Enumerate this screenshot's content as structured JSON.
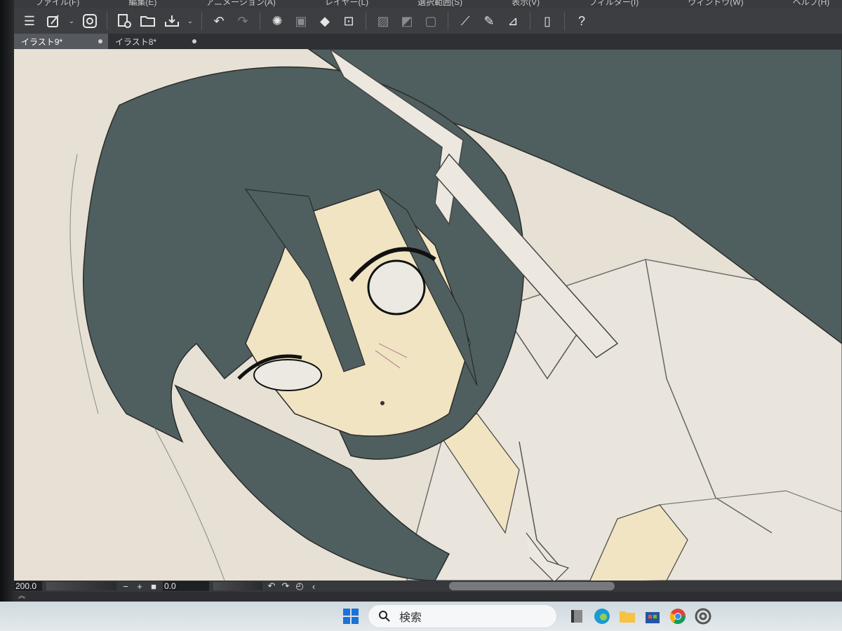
{
  "menu": [
    "ファイル(F)",
    "編集(E)",
    "アニメーション(A)",
    "レイヤー(L)",
    "選択範囲(S)",
    "表示(V)",
    "フィルター(I)",
    "ウィンドウ(W)",
    "ヘルプ(H)"
  ],
  "toolbar": {
    "icons": [
      "menu-icon",
      "brush-settings-icon",
      "clip-studio-icon",
      "new-canvas-icon",
      "open-folder-icon",
      "save-icon",
      "undo-icon",
      "redo-icon",
      "loading-icon",
      "transform-icon",
      "fill-icon",
      "resize-icon",
      "deselect-icon",
      "invert-selection-icon",
      "border-icon",
      "ruler-icon",
      "pen-icon",
      "line-icon",
      "tablet-icon",
      "help-icon"
    ]
  },
  "tabs": [
    {
      "label": "イラスト9*",
      "active": true
    },
    {
      "label": "イラスト8*",
      "active": false
    }
  ],
  "status": {
    "zoom": "200.0",
    "angle": "0.0",
    "zoom_out": "−",
    "zoom_in": "+",
    "rotate_left": "↶",
    "rotate_right": "↷",
    "reset": "◴",
    "prev": "‹"
  },
  "taskbar": {
    "search_text": "検索"
  },
  "colors": {
    "hair": "#4f5f5f",
    "skin": "#f1e4c2",
    "paper": "#e6e1d4",
    "line": "#2b2b2b",
    "active_tab": "#56595f"
  }
}
